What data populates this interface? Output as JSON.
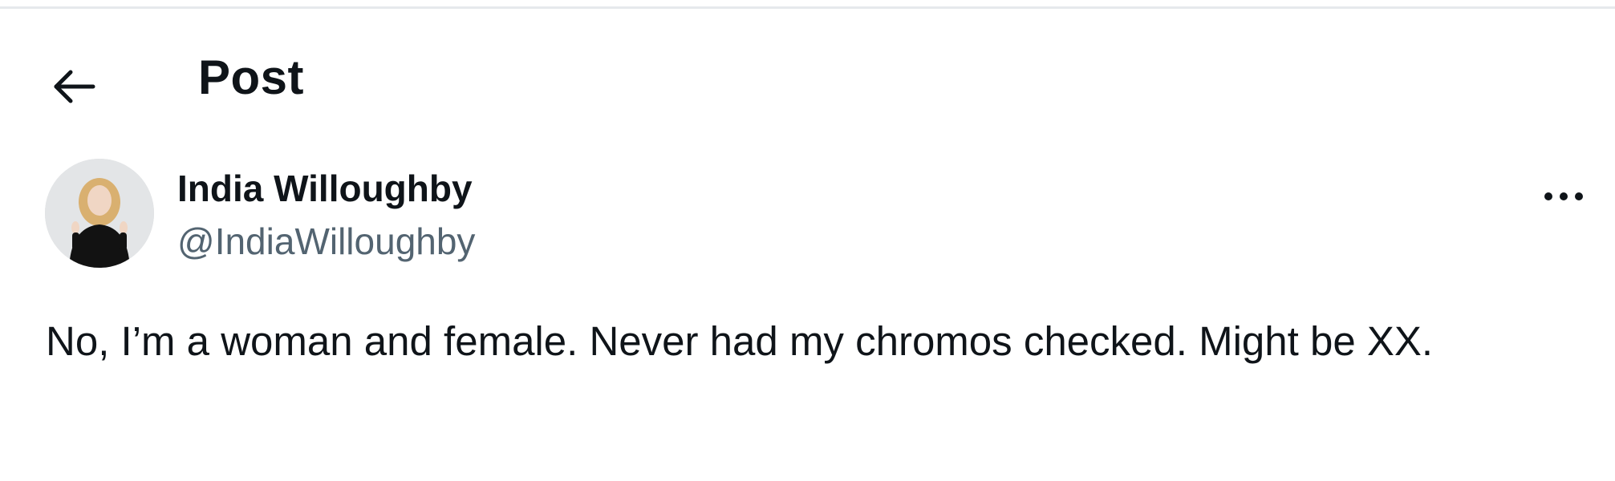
{
  "header": {
    "back_icon": "arrow-left-icon",
    "title": "Post"
  },
  "post": {
    "author": {
      "display_name": "India Willoughby",
      "handle": "@IndiaWilloughby",
      "avatar_icon": "profile-photo"
    },
    "more_icon": "more-horizontal-icon",
    "text": "No, I’m a woman and female. Never had my chromos checked. Might be XX."
  },
  "colors": {
    "text_primary": "#0f1419",
    "text_secondary": "#536471",
    "divider": "#e6e9ec",
    "background": "#ffffff"
  }
}
